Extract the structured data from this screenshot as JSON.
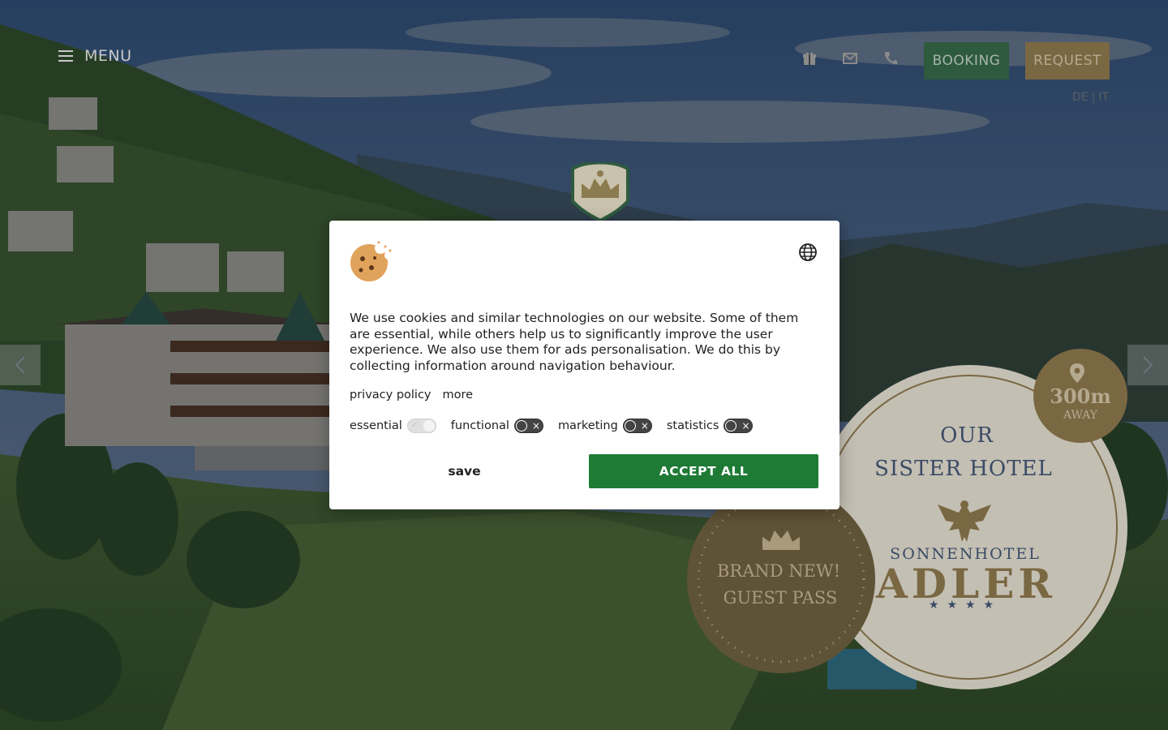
{
  "header": {
    "menu_label": "MENU",
    "booking_label": "BOOKING",
    "request_label": "REQUEST",
    "icons": [
      "gift-icon",
      "mail-icon",
      "phone-icon"
    ],
    "lang_de": "DE",
    "lang_sep": "|",
    "lang_it": "IT"
  },
  "colors": {
    "booking_bg": "#2e5a3e",
    "request_bg": "#7a6843",
    "accept_bg": "#1e7a35",
    "sister_text": "#3b4a66",
    "gold": "#7a6843"
  },
  "sister_hotel": {
    "line1": "OUR",
    "line2": "SISTER HOTEL",
    "name": "SONNENHOTEL",
    "brand": "ADLER",
    "stars": "★★★★"
  },
  "distance_badge": {
    "value": "300m",
    "label": "AWAY"
  },
  "guest_pass": {
    "line1": "BRAND NEW!",
    "line2": "GUEST PASS"
  },
  "cookie_dialog": {
    "text": "We use cookies and similar technologies on our website. Some of them are essential, while others help us to significantly improve the user experience. We also use them for ads personalisation. We do this by collecting information around navigation behaviour.",
    "privacy_link": "privacy policy",
    "more_link": "more",
    "categories": [
      {
        "label": "essential",
        "enabled": true,
        "locked": true
      },
      {
        "label": "functional",
        "enabled": false
      },
      {
        "label": "marketing",
        "enabled": false
      },
      {
        "label": "statistics",
        "enabled": false
      }
    ],
    "save_label": "save",
    "accept_label": "ACCEPT ALL"
  }
}
